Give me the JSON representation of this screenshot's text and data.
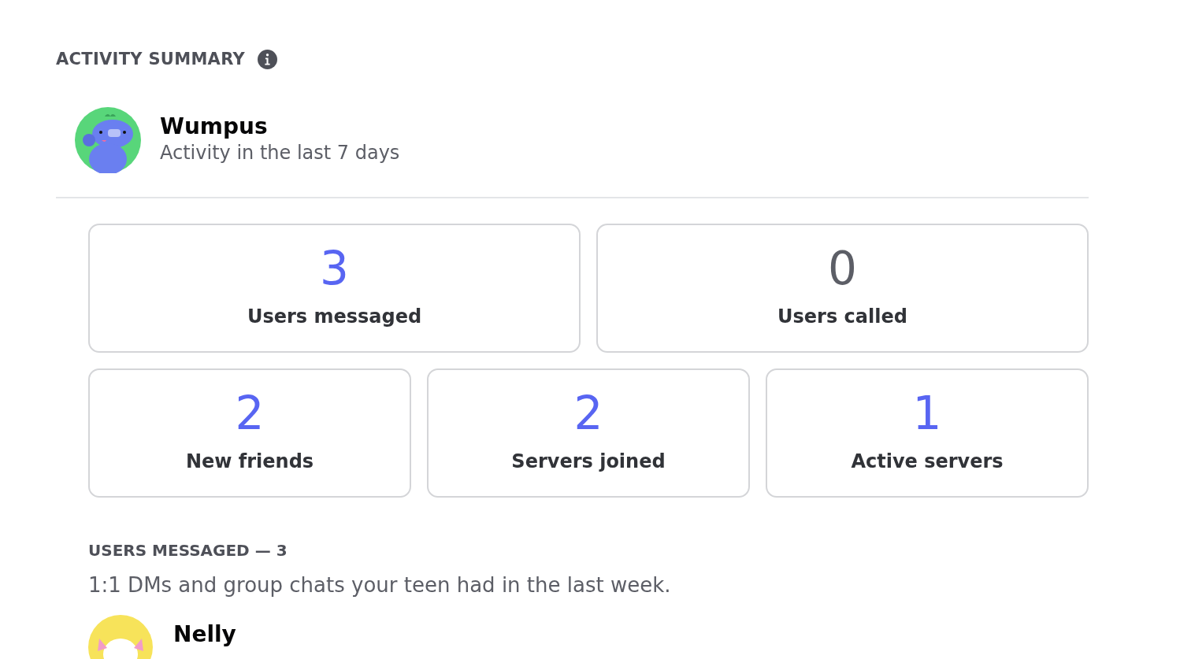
{
  "header": {
    "title": "ACTIVITY SUMMARY"
  },
  "profile": {
    "name": "Wumpus",
    "subtitle": "Activity in the last 7 days"
  },
  "stat_rows": [
    [
      {
        "value": "3",
        "label": "Users messaged",
        "color": "#5865f2"
      },
      {
        "value": "0",
        "label": "Users called",
        "color": "#5c5e66"
      }
    ],
    [
      {
        "value": "2",
        "label": "New friends",
        "color": "#5865f2"
      },
      {
        "value": "2",
        "label": "Servers joined",
        "color": "#5865f2"
      },
      {
        "value": "1",
        "label": "Active servers",
        "color": "#5865f2"
      }
    ]
  ],
  "section": {
    "title": "USERS MESSAGED — 3",
    "description": "1:1 DMs and group chats your teen had in the last week."
  },
  "users": [
    {
      "name": "Nelly"
    }
  ]
}
